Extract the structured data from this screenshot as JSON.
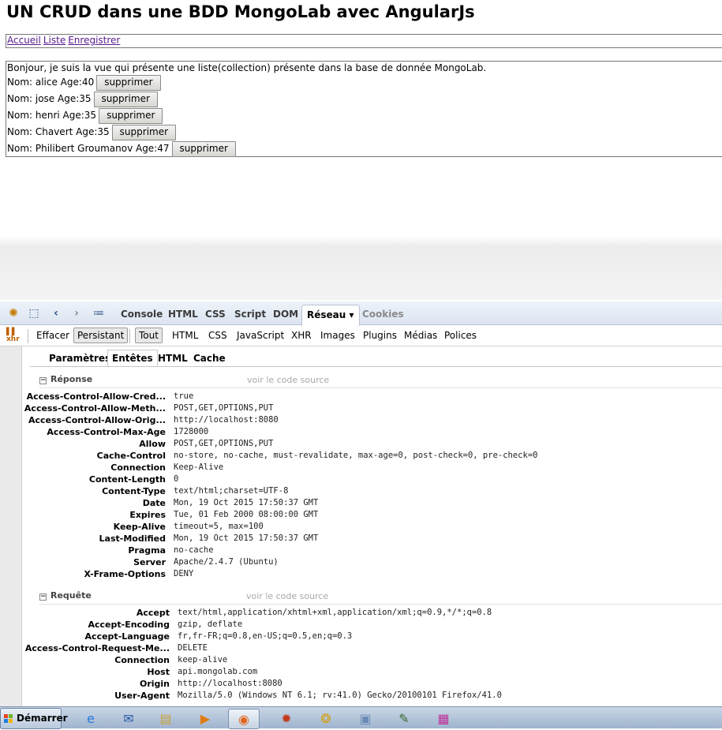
{
  "page": {
    "title": "UN CRUD dans une BDD MongoLab avec AngularJs",
    "nav": [
      "Accueil",
      "Liste",
      "Enregistrer"
    ],
    "intro": "Bonjour, je suis la vue qui présente une liste(collection) présente dans la base de donnée MongoLab.",
    "delete_label": "supprimer",
    "people": [
      {
        "text": "Nom: alice Age:40"
      },
      {
        "text": "Nom: jose Age:35"
      },
      {
        "text": "Nom: henri Age:35"
      },
      {
        "text": "Nom: Chavert Age:35"
      },
      {
        "text": "Nom: Philibert Groumanov Age:47"
      }
    ]
  },
  "firebug": {
    "main_tabs": [
      "Console",
      "HTML",
      "CSS",
      "Script",
      "DOM",
      "Réseau ▾",
      "Cookies"
    ],
    "net_icon_label": "xhr",
    "toolbar": {
      "clear": "Effacer",
      "persist": "Persistant",
      "filters": [
        "Tout",
        "HTML",
        "CSS",
        "JavaScript",
        "XHR",
        "Images",
        "Plugins",
        "Médias",
        "Polices"
      ]
    },
    "request_tabs": [
      "Paramètres",
      "Entêtes",
      "HTML",
      "Cache"
    ],
    "view_source": "voir le code source",
    "response": {
      "title": "Réponse",
      "headers": [
        {
          "name": "Access-Control-Allow-Cred...",
          "value": "true"
        },
        {
          "name": "Access-Control-Allow-Meth...",
          "value": "POST,GET,OPTIONS,PUT"
        },
        {
          "name": "Access-Control-Allow-Orig...",
          "value": "http://localhost:8080"
        },
        {
          "name": "Access-Control-Max-Age",
          "value": "1728000"
        },
        {
          "name": "Allow",
          "value": "POST,GET,OPTIONS,PUT"
        },
        {
          "name": "Cache-Control",
          "value": "no-store, no-cache, must-revalidate, max-age=0, post-check=0, pre-check=0"
        },
        {
          "name": "Connection",
          "value": "Keep-Alive"
        },
        {
          "name": "Content-Length",
          "value": "0"
        },
        {
          "name": "Content-Type",
          "value": "text/html;charset=UTF-8"
        },
        {
          "name": "Date",
          "value": "Mon, 19 Oct 2015 17:50:37 GMT"
        },
        {
          "name": "Expires",
          "value": "Tue, 01 Feb 2000 08:00:00 GMT"
        },
        {
          "name": "Keep-Alive",
          "value": "timeout=5, max=100"
        },
        {
          "name": "Last-Modified",
          "value": "Mon, 19 Oct 2015 17:50:37 GMT"
        },
        {
          "name": "Pragma",
          "value": "no-cache"
        },
        {
          "name": "Server",
          "value": "Apache/2.4.7 (Ubuntu)"
        },
        {
          "name": "X-Frame-Options",
          "value": "DENY"
        }
      ]
    },
    "request": {
      "title": "Requête",
      "headers": [
        {
          "name": "Accept",
          "value": "text/html,application/xhtml+xml,application/xml;q=0.9,*/*;q=0.8"
        },
        {
          "name": "Accept-Encoding",
          "value": "gzip, deflate"
        },
        {
          "name": "Accept-Language",
          "value": "fr,fr-FR;q=0.8,en-US;q=0.5,en;q=0.3"
        },
        {
          "name": "Access-Control-Request-Me...",
          "value": "DELETE"
        },
        {
          "name": "Connection",
          "value": "keep-alive"
        },
        {
          "name": "Host",
          "value": "api.mongolab.com"
        },
        {
          "name": "Origin",
          "value": "http://localhost:8080"
        },
        {
          "name": "User-Agent",
          "value": "Mozilla/5.0 (Windows NT 6.1; rv:41.0) Gecko/20100101 Firefox/41.0"
        }
      ]
    }
  },
  "taskbar": {
    "start_label": "Démarrer",
    "apps": [
      "ie-icon",
      "thunderbird-icon",
      "explorer-icon",
      "media-player-icon",
      "firefox-icon",
      "app-icon",
      "app2-icon",
      "network-icon",
      "editor-icon",
      "image-viewer-icon"
    ]
  }
}
